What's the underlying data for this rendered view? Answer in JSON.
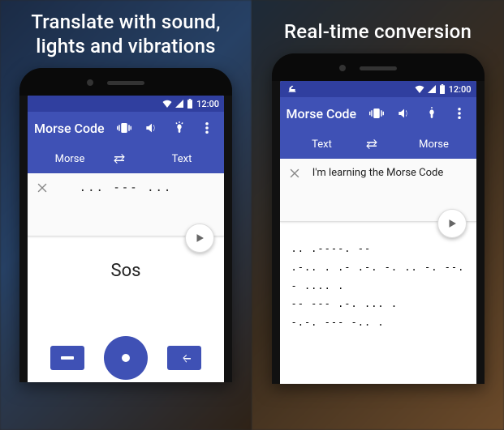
{
  "colors": {
    "primary": "#3f51b5",
    "primaryDark": "#303f9f"
  },
  "leftPanel": {
    "headline": "Translate with sound, lights and vibrations",
    "statusbar": {
      "time": "12:00"
    },
    "appTitle": "Morse Code",
    "tabs": {
      "left": "Morse",
      "right": "Text",
      "swapIcon": "swap-icon"
    },
    "inputValue": "... --- ...",
    "outputValue": "Sos",
    "controls": {
      "dash": "—",
      "dot": "•",
      "back": "←"
    }
  },
  "rightPanel": {
    "headline": "Real-time conversion",
    "statusbar": {
      "time": "12:00"
    },
    "appTitle": "Morse Code",
    "tabs": {
      "left": "Text",
      "right": "Morse",
      "swapIcon": "swap-icon"
    },
    "inputValue": "I'm learning the Morse Code",
    "outputValue": ".. .----. --\n.-.. . .- .-. -. .. -. --.\n- .... .\n-- --- .-. ... .\n-.-. --- -.. ."
  }
}
